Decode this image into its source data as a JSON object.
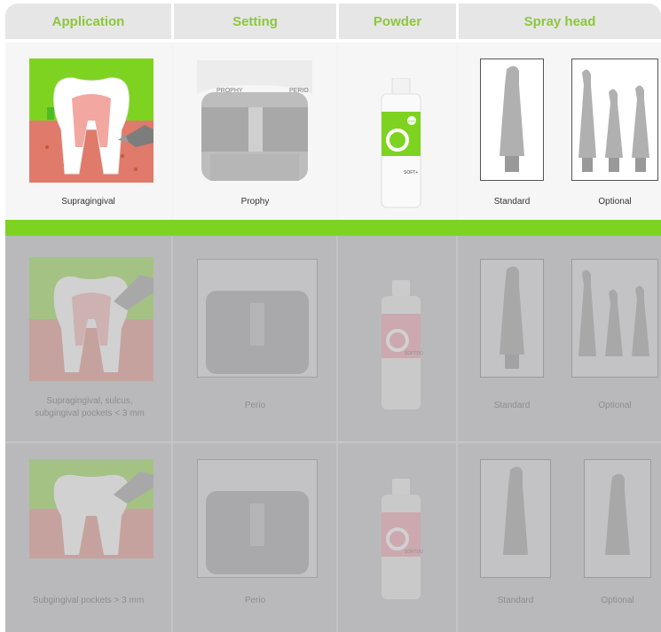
{
  "headers": {
    "application": "Application",
    "setting": "Setting",
    "powder": "Powder",
    "spray_head": "Spray head"
  },
  "rows": [
    {
      "application": "Supragingival",
      "setting": "Prophy",
      "spray_standard": "Standard",
      "spray_optional": "Optional"
    },
    {
      "application": "Supragingival, sulcus, subgingival pockets < 3 mm",
      "setting": "Perio",
      "spray_standard": "Standard",
      "spray_optional": "Optional"
    },
    {
      "application": "Subgingival pockets > 3 mm",
      "setting": "Perio",
      "spray_standard": "Standard",
      "spray_optional": "Optional"
    }
  ],
  "device_labels": {
    "prophy": "PROPHY",
    "perio": "PERIO"
  },
  "powder_labels": {
    "brand": "EMS",
    "name_row1": "SOFT+",
    "name_row2": "SOFTDO",
    "name_row3": "SOFTDO"
  },
  "colors": {
    "accent_green": "#7ed321",
    "header_text": "#8dc63f",
    "header_bg": "#e6e6e6",
    "dim_overlay": "#b9b9bb"
  }
}
